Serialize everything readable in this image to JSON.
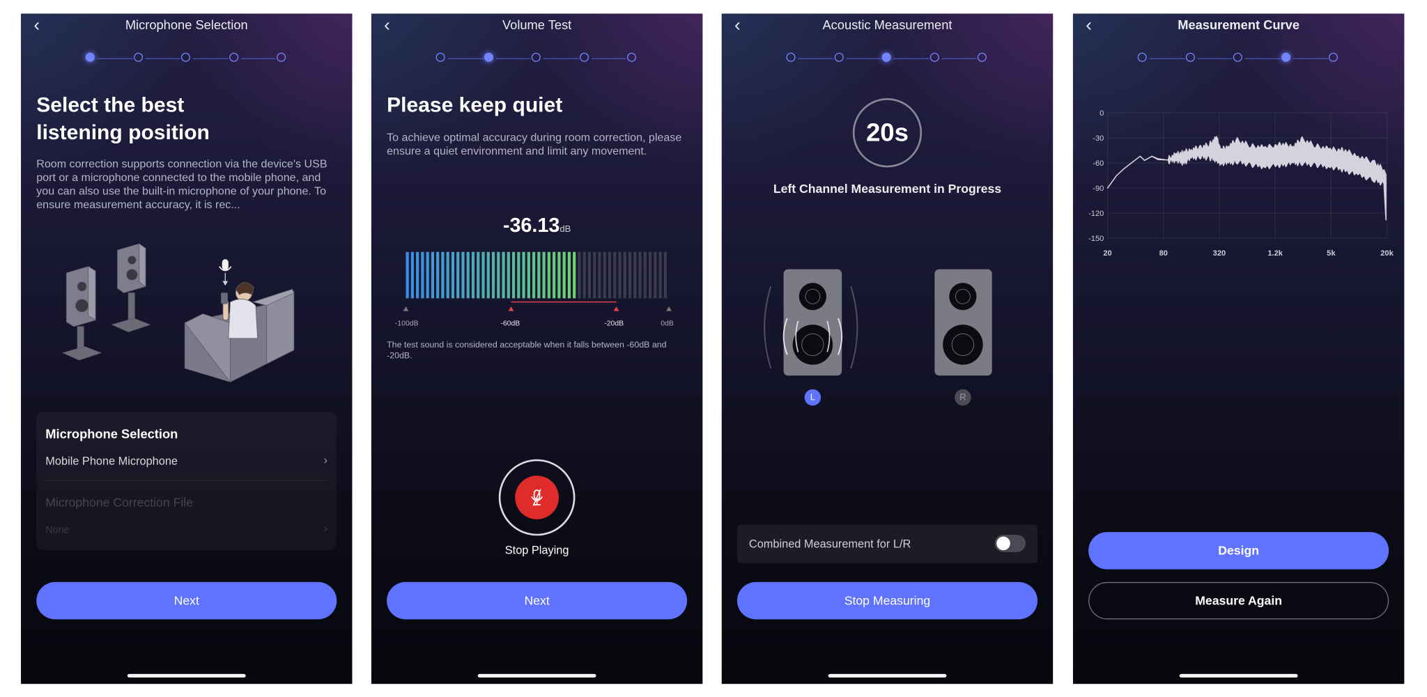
{
  "colors": {
    "accent": "#5f73ff",
    "step_active": "#7384ff",
    "record_red": "#e02b2b",
    "meter_inactive": "#3b3b4c",
    "range_red": "#e0424a"
  },
  "screens": [
    {
      "title": "Microphone Selection",
      "active_step": 0,
      "step_count": 5,
      "heading_lines": [
        "Select the best",
        "listening position"
      ],
      "description": "Room correction supports connection via the device's USB port or a microphone connected to the mobile phone, and you can also use the built-in microphone of your phone. To ensure measurement accuracy, it is rec...",
      "illustration": "speakers-and-listener-illustration",
      "card": {
        "title": "Microphone Selection",
        "selected": "Mobile Phone Microphone",
        "correction_label": "Microphone Correction File",
        "correction_value": "None"
      },
      "button": "Next"
    },
    {
      "title": "Volume Test",
      "active_step": 1,
      "step_count": 5,
      "heading": "Please keep quiet",
      "description": "To achieve optimal accuracy during room correction, please ensure a quiet environment and limit any movement.",
      "level_value": "-36.13",
      "level_unit": "dB",
      "meter": {
        "level_db": -36.13,
        "min_db": -100,
        "max_db": 0,
        "acceptable_range_db": [
          -60,
          -20
        ]
      },
      "meter_labels": [
        "-100dB",
        "-60dB",
        "-20dB",
        "0dB"
      ],
      "note": "The test sound is considered acceptable when it falls between -60dB and -20dB.",
      "record_icon": "microphone-off-icon",
      "record_label": "Stop Playing",
      "button": "Next"
    },
    {
      "title": "Acoustic Measurement",
      "active_step": 2,
      "step_count": 5,
      "countdown": "20s",
      "status": "Left Channel Measurement in Progress",
      "left_badge": "L",
      "right_badge": "R",
      "active_channel": "L",
      "combined_label": "Combined Measurement for L/R",
      "combined_enabled": false,
      "button": "Stop Measuring"
    },
    {
      "title": "Measurement Curve",
      "active_step": 3,
      "step_count": 5,
      "primary_button": "Design",
      "secondary_button": "Measure Again"
    }
  ],
  "chart_data": {
    "type": "area",
    "x_scale": "log",
    "xlim": [
      20,
      20000
    ],
    "ylim": [
      -150,
      0
    ],
    "x_ticks": [
      {
        "value": 20,
        "label": "20"
      },
      {
        "value": 80,
        "label": "80"
      },
      {
        "value": 320,
        "label": "320"
      },
      {
        "value": 1280,
        "label": "1.2k"
      },
      {
        "value": 5120,
        "label": "5k"
      },
      {
        "value": 20480,
        "label": "20k"
      }
    ],
    "y_ticks": [
      {
        "value": 0,
        "label": "0"
      },
      {
        "value": -30,
        "label": "-30"
      },
      {
        "value": -60,
        "label": "-60"
      },
      {
        "value": -90,
        "label": "-90"
      },
      {
        "value": -120,
        "label": "-120"
      },
      {
        "value": -150,
        "label": "-150"
      }
    ],
    "grid": true,
    "series_color": "#d4d2dc",
    "frequency": [
      20,
      25,
      30,
      38,
      45,
      50,
      60,
      70,
      90,
      110,
      130,
      160,
      200,
      250,
      300,
      330,
      400,
      500,
      700,
      1000,
      1500,
      2000,
      2500,
      3500,
      5000,
      7000,
      10000,
      15000,
      19000,
      20000
    ],
    "upper_db": [
      -90,
      -75,
      -67,
      -58,
      -52,
      -57,
      -52,
      -55,
      -55,
      -50,
      -48,
      -44,
      -42,
      -38,
      -30,
      -45,
      -40,
      -33,
      -40,
      -42,
      -38,
      -40,
      -32,
      -40,
      -44,
      -45,
      -52,
      -60,
      -68,
      -74
    ],
    "lower_db": [
      -90,
      -75,
      -67,
      -58,
      -52,
      -57,
      -52,
      -56,
      -58,
      -56,
      -60,
      -54,
      -52,
      -54,
      -56,
      -60,
      -60,
      -58,
      -62,
      -64,
      -62,
      -60,
      -60,
      -62,
      -64,
      -68,
      -74,
      -80,
      -85,
      -128
    ]
  }
}
